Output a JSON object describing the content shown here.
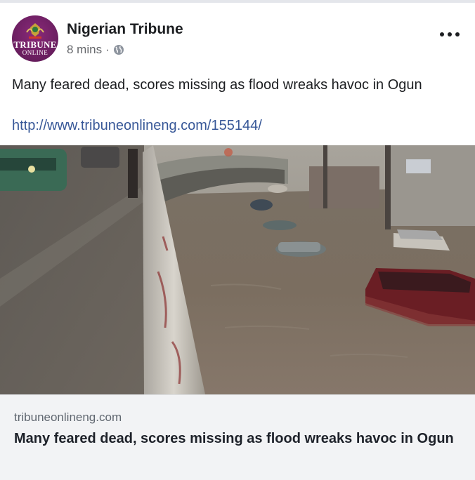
{
  "post": {
    "page_name": "Nigerian Tribune",
    "timestamp": "8 mins",
    "separator": "·",
    "privacy_icon": "globe-icon",
    "avatar": {
      "line1": "TRIBUNE",
      "line2": "ONLINE",
      "color": "#6d1f62"
    },
    "more_icon": "more-dots-icon",
    "text": "Many feared dead, scores missing as flood wreaks havoc in Ogun",
    "link_url": "http://www.tribuneonlineng.com/155144/"
  },
  "link_preview": {
    "domain": "tribuneonlineng.com",
    "title": "Many feared dead, scores missing as flood wreaks havoc in Ogun"
  },
  "colors": {
    "link": "#385898",
    "muted": "#65676b",
    "card_bg": "#f2f3f5"
  }
}
